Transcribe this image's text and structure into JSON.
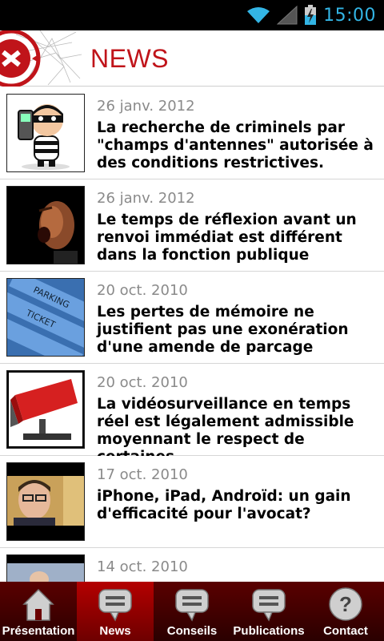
{
  "status_bar": {
    "time": "15:00",
    "icons": [
      "wifi-icon",
      "signal-icon",
      "battery-charging-icon"
    ],
    "time_color": "#33b5e5"
  },
  "header": {
    "title": "NEWS",
    "title_color": "#c0141a",
    "logo_icon": "app-logo-icon"
  },
  "news": [
    {
      "date": "26 janv. 2012",
      "title": "La recherche de criminels par \"champs d'antennes\" autorisée à des conditions restrictives.",
      "thumb": "burglar-thumbnail"
    },
    {
      "date": "26 janv. 2012",
      "title": "Le temps de réflexion avant un renvoi immédiat est différent dans la fonction publique",
      "thumb": "shouting-man-thumbnail"
    },
    {
      "date": "20 oct. 2010",
      "title": "Les pertes de mémoire ne justifient pas une exonération d'une amende de parcage",
      "thumb": "parking-ticket-thumbnail"
    },
    {
      "date": "20 oct. 2010",
      "title": "La vidéosurveillance en temps réel est légalement admissible moyennant le respect de certaines",
      "thumb": "security-camera-thumbnail"
    },
    {
      "date": "17 oct. 2010",
      "title": "iPhone, iPad, Androïd: un gain d'efficacité pour l'avocat?",
      "thumb": "man-portrait-thumbnail"
    },
    {
      "date": "14 oct. 2010",
      "title": "",
      "thumb": "partial-thumbnail"
    }
  ],
  "bottom_nav": {
    "active_tab": "News",
    "tabs": [
      {
        "label": "Présentation",
        "icon": "home-icon"
      },
      {
        "label": "News",
        "icon": "speech-bubble-icon"
      },
      {
        "label": "Conseils",
        "icon": "speech-bubble-icon"
      },
      {
        "label": "Publications",
        "icon": "speech-bubble-icon"
      },
      {
        "label": "Contact",
        "icon": "question-icon"
      }
    ]
  }
}
